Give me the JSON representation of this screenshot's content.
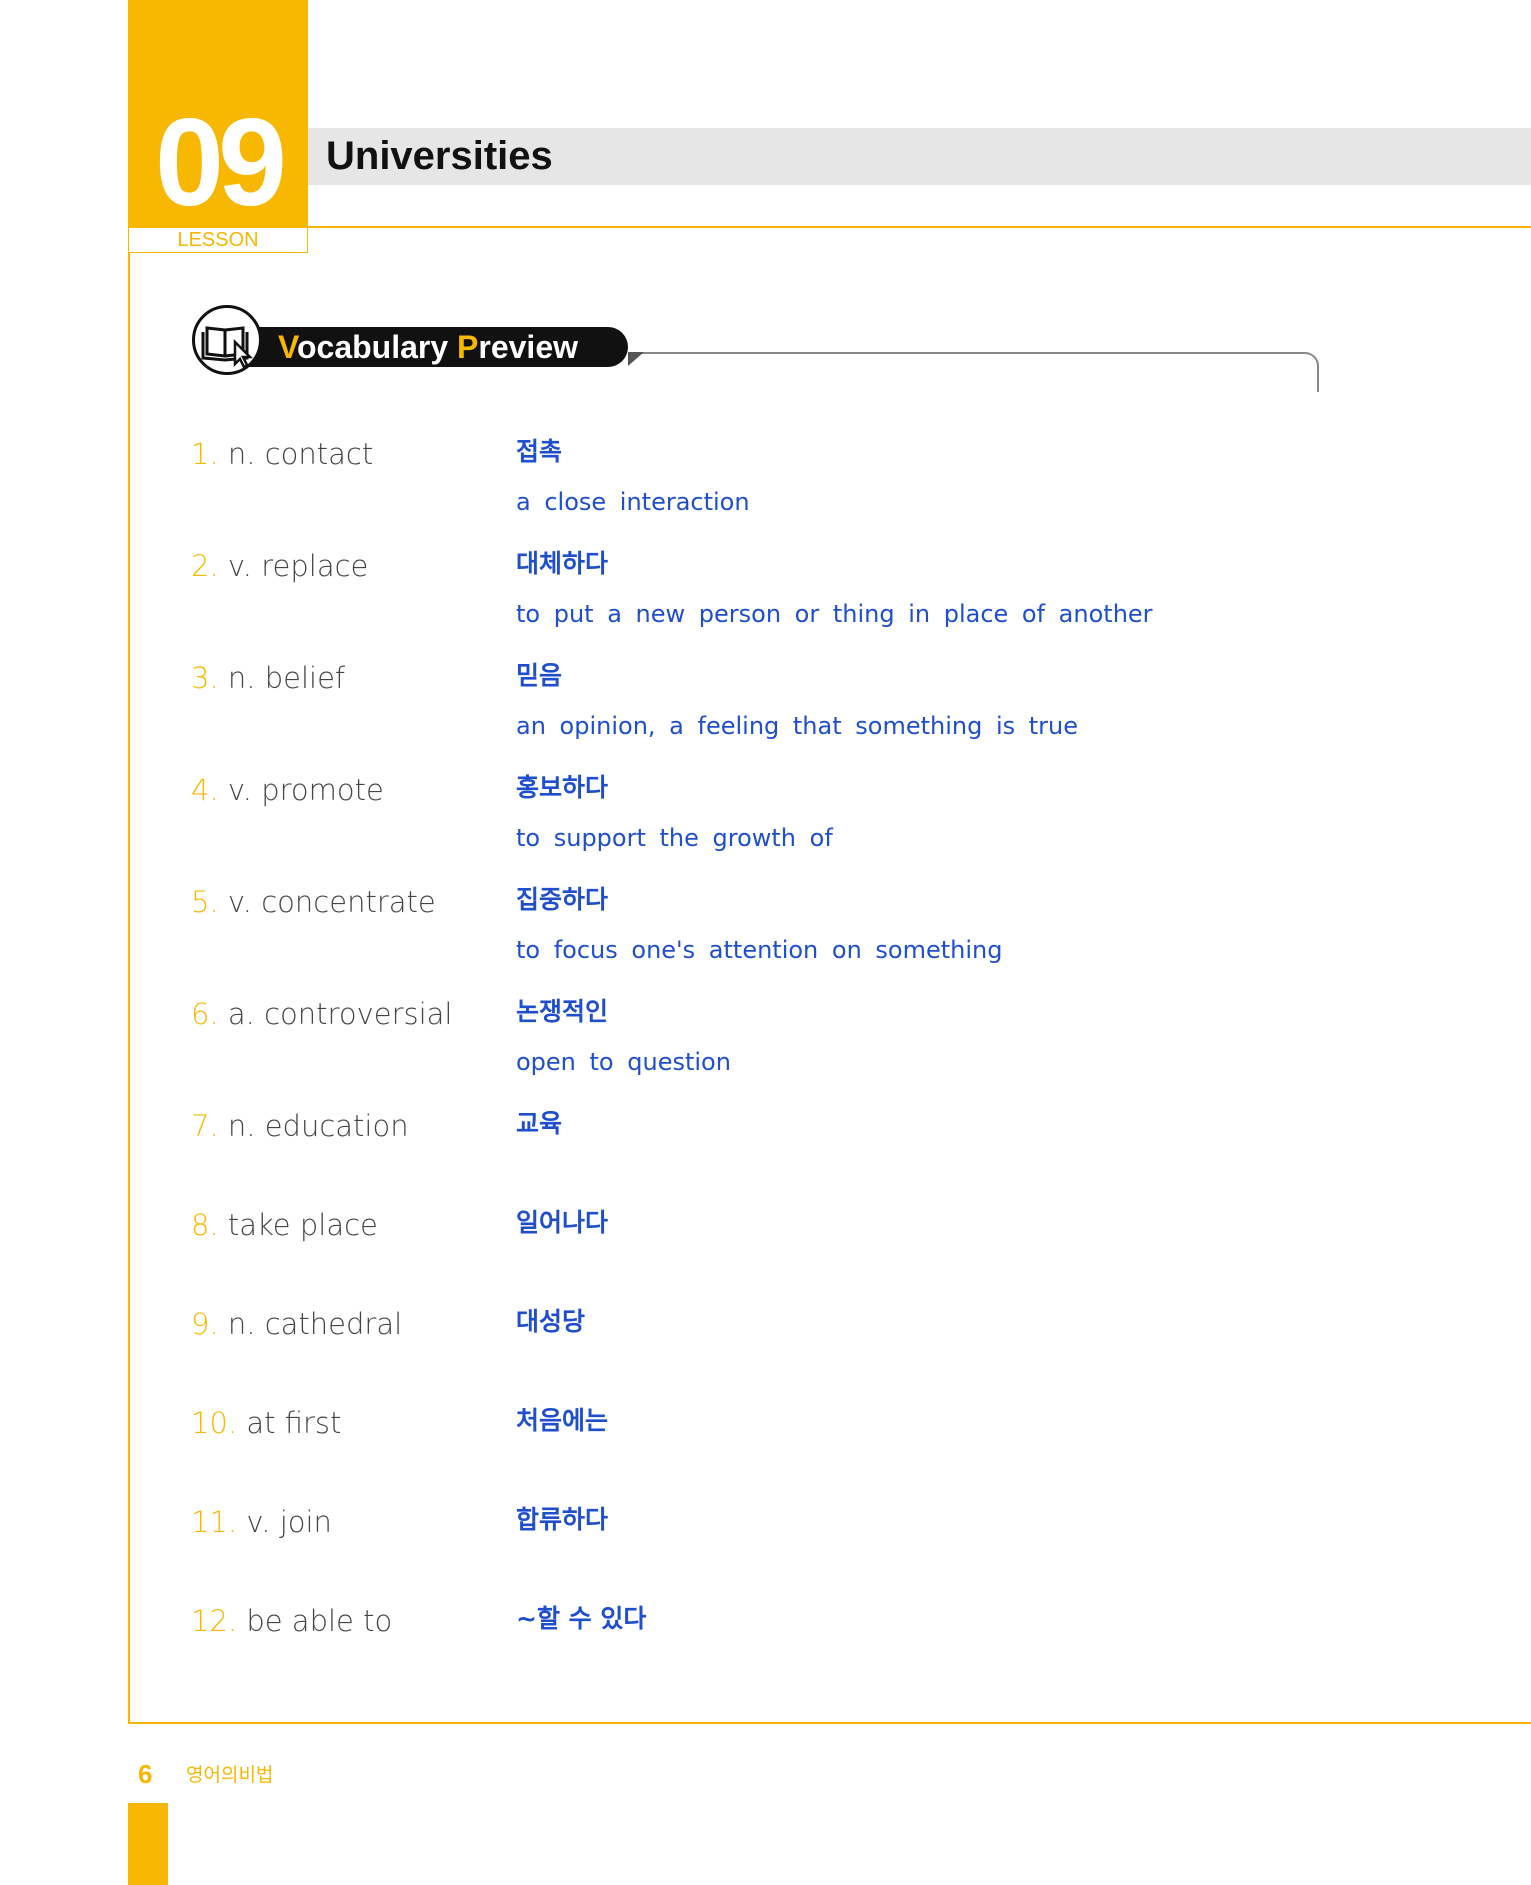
{
  "lesson": {
    "number": "09",
    "label": "LESSON"
  },
  "title": "Universities",
  "section": {
    "title_first_letter": "V",
    "title_rest": "ocabulary ",
    "title_second_letter": "P",
    "title_second_rest": "review",
    "icon": "book-cursor-icon"
  },
  "vocabulary": [
    {
      "num": "1.",
      "term": "n. contact",
      "korean": "접촉",
      "definition": "a close interaction"
    },
    {
      "num": "2.",
      "term": "v. replace",
      "korean": "대체하다",
      "definition": "to put a new person or thing in place of another"
    },
    {
      "num": "3.",
      "term": "n. belief",
      "korean": "믿음",
      "definition": "an opinion, a feeling that something is true"
    },
    {
      "num": "4.",
      "term": "v. promote",
      "korean": "홍보하다",
      "definition": "to support the growth of"
    },
    {
      "num": "5.",
      "term": "v. concentrate",
      "korean": "집중하다",
      "definition": "to focus one's attention on something"
    },
    {
      "num": "6.",
      "term": "a. controversial",
      "korean": "논쟁적인",
      "definition": "open to question"
    },
    {
      "num": "7.",
      "term": "n. education",
      "korean": "교육"
    },
    {
      "num": "8.",
      "term": "take place",
      "korean": "일어나다"
    },
    {
      "num": "9.",
      "term": "n. cathedral",
      "korean": "대성당"
    },
    {
      "num": "10.",
      "term": "at first",
      "korean": "처음에는"
    },
    {
      "num": "11.",
      "term": "v. join",
      "korean": "합류하다"
    },
    {
      "num": "12.",
      "term": "be able to",
      "korean": "~할 수 있다"
    }
  ],
  "footer": {
    "page_number": "6",
    "book_name": "영어의비법"
  },
  "colors": {
    "accent": "#F8B700",
    "korean_text": "#1F4FCC",
    "title_bar": "#E6E6E6"
  }
}
